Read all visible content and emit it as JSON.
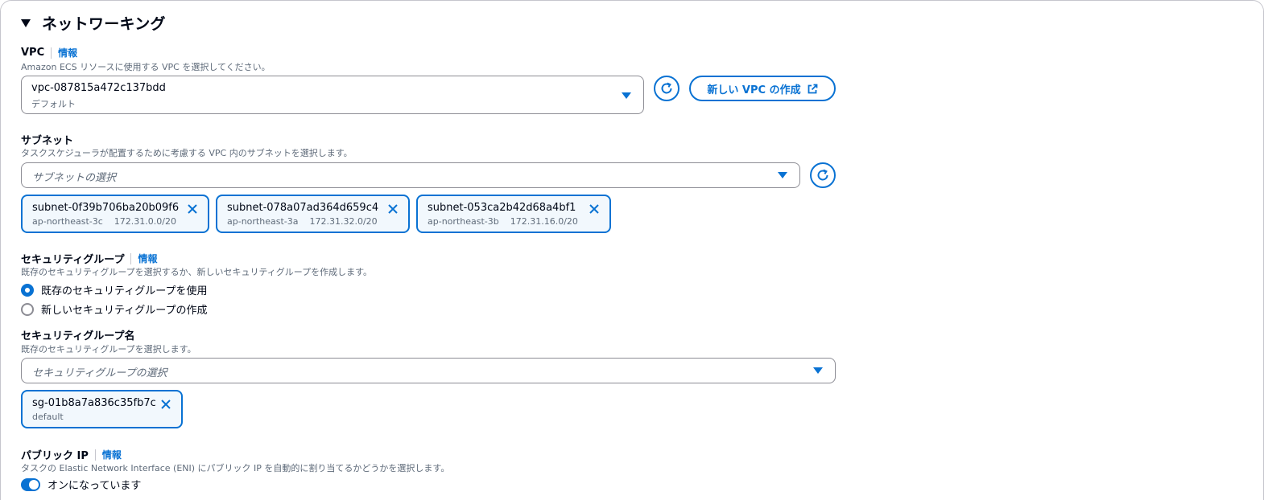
{
  "section": {
    "title": "ネットワーキング"
  },
  "vpc": {
    "label": "VPC",
    "info": "情報",
    "description": "Amazon ECS リソースに使用する VPC を選択してください。",
    "selected_value": "vpc-087815a472c137bdd",
    "selected_sub": "デフォルト",
    "create_button": "新しい VPC の作成"
  },
  "subnets": {
    "label": "サブネット",
    "description": "タスクスケジューラが配置するために考慮する VPC 内のサブネットを選択します。",
    "placeholder": "サブネットの選択",
    "tokens": [
      {
        "id": "subnet-0f39b706ba20b09f6",
        "az": "ap-northeast-3c",
        "cidr": "172.31.0.0/20"
      },
      {
        "id": "subnet-078a07ad364d659c4",
        "az": "ap-northeast-3a",
        "cidr": "172.31.32.0/20"
      },
      {
        "id": "subnet-053ca2b42d68a4bf1",
        "az": "ap-northeast-3b",
        "cidr": "172.31.16.0/20"
      }
    ]
  },
  "security_group": {
    "label": "セキュリティグループ",
    "info": "情報",
    "description": "既存のセキュリティグループを選択するか、新しいセキュリティグループを作成します。",
    "options": [
      {
        "label": "既存のセキュリティグループを使用",
        "checked": true
      },
      {
        "label": "新しいセキュリティグループの作成",
        "checked": false
      }
    ]
  },
  "security_group_name": {
    "label": "セキュリティグループ名",
    "description": "既存のセキュリティグループを選択します。",
    "placeholder": "セキュリティグループの選択",
    "token": {
      "id": "sg-01b8a7a836c35fb7c",
      "sub": "default"
    }
  },
  "public_ip": {
    "label": "パブリック IP",
    "info": "情報",
    "description": "タスクの Elastic Network Interface (ENI) にパブリック IP を自動的に割り当てるかどうかを選択します。",
    "toggle_label": "オンになっています",
    "enabled": true
  },
  "colors": {
    "accent": "#0972d3",
    "text": "#000716",
    "muted": "#5f6b7a",
    "border": "#8c8c94"
  }
}
